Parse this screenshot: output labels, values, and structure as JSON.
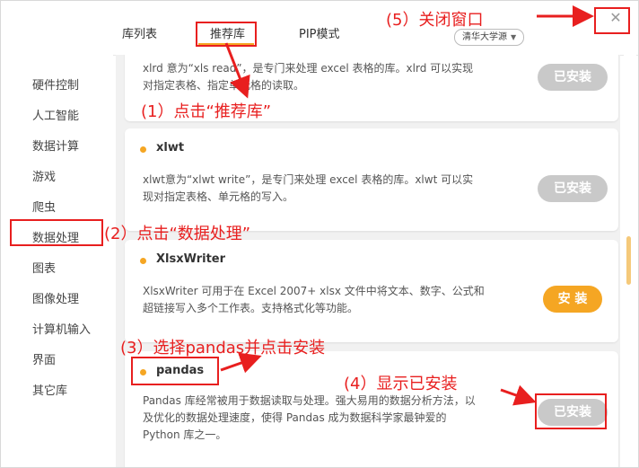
{
  "tabs": {
    "libs": "库列表",
    "recommended": "推荐库",
    "pip": "PIP模式"
  },
  "mirror": {
    "selected": "清华大学源"
  },
  "sidebar": {
    "items": [
      "硬件控制",
      "人工智能",
      "数据计算",
      "游戏",
      "爬虫",
      "数据处理",
      "图表",
      "图像处理",
      "计算机输入",
      "界面",
      "其它库"
    ],
    "selected": "数据处理"
  },
  "cards": [
    {
      "name": "",
      "desc_line1": "xlrd 意为“xls read”，是专门来处理 excel 表格的库。xlrd 可以实现",
      "desc_line2": "对指定表格、指定单元格的读取。",
      "button": "已安装",
      "status": "installed"
    },
    {
      "name": "xlwt",
      "desc_line1": "xlwt意为“xlwt write”，是专门来处理 excel 表格的库。xlwt 可以实",
      "desc_line2": "现对指定表格、单元格的写入。",
      "button": "已安装",
      "status": "installed"
    },
    {
      "name": "XlsxWriter",
      "desc_line1": "XlsxWriter 可用于在 Excel 2007+ xlsx 文件中将文本、数字、公式和",
      "desc_line2": "超链接写入多个工作表。支持格式化等功能。",
      "button": "安 装",
      "status": "not_installed"
    },
    {
      "name": "pandas",
      "desc_line1": "Pandas 库经常被用于数据读取与处理。强大易用的数据分析方法，以",
      "desc_line2": "及优化的数据处理速度，使得 Pandas 成为数据科学家最钟爱的",
      "desc_line3": "Python 库之一。",
      "button": "已安装",
      "status": "installed"
    }
  ],
  "annotations": {
    "step1": "(1）点击“推荐库”",
    "step2": "(2）点击“数据处理”",
    "step3": "(3）选择pandas并点击安装",
    "step4": "(4）显示已安装",
    "step5": "(5）关闭窗口"
  },
  "colors": {
    "accent": "#f5a623",
    "annotation": "#e81f1f",
    "installed_button": "#c9c9c9"
  }
}
